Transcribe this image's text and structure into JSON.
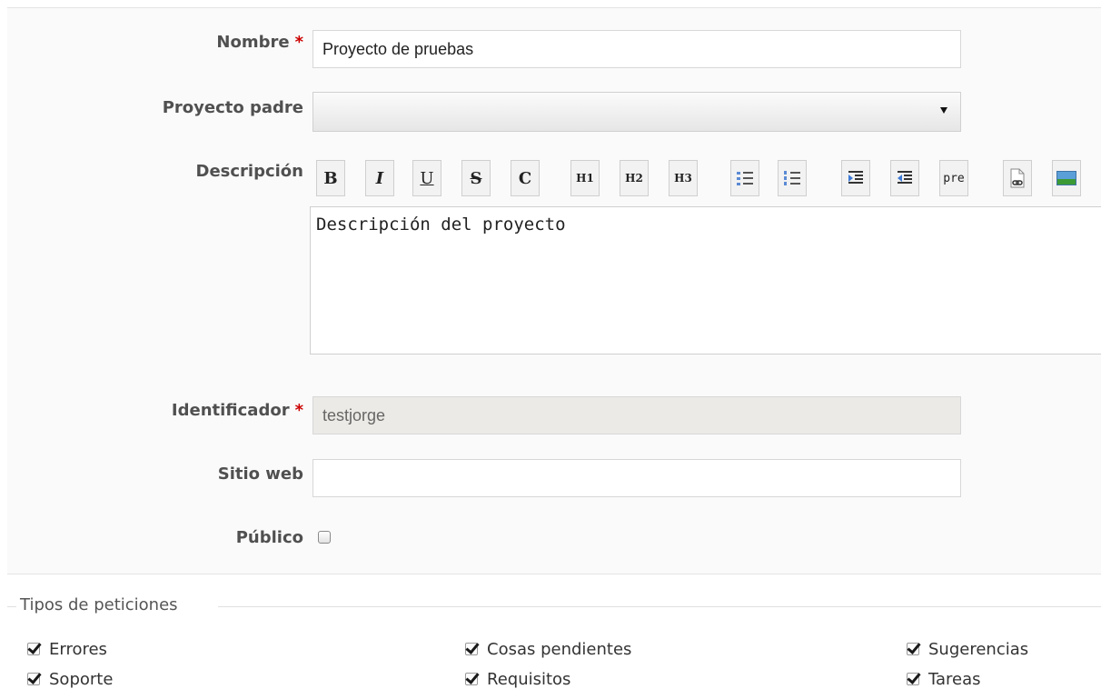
{
  "form": {
    "name": {
      "label": "Nombre",
      "required": "*",
      "value": "Proyecto de pruebas"
    },
    "parent": {
      "label": "Proyecto padre",
      "selected": ""
    },
    "description": {
      "label": "Descripción",
      "value": "Descripción del proyecto",
      "toolbar": {
        "bold": "B",
        "italic": "I",
        "underline": "U",
        "strike": "S",
        "code": "C",
        "h1": "H1",
        "h2": "H2",
        "h3": "H3",
        "pre": "pre"
      }
    },
    "identifier": {
      "label": "Identificador",
      "required": "*",
      "value": "testjorge"
    },
    "homepage": {
      "label": "Sitio web",
      "value": ""
    },
    "public": {
      "label": "Público",
      "checked": false
    }
  },
  "trackers": {
    "legend": "Tipos de peticiones",
    "items": [
      {
        "label": "Errores",
        "checked": true
      },
      {
        "label": "Cosas pendientes",
        "checked": true
      },
      {
        "label": "Sugerencias",
        "checked": true
      },
      {
        "label": "Soporte",
        "checked": true
      },
      {
        "label": "Requisitos",
        "checked": true
      },
      {
        "label": "Tareas",
        "checked": true
      }
    ]
  },
  "icons": {
    "select_arrow": "caret-down-icon",
    "ul": "unordered-list-icon",
    "ol": "ordered-list-icon",
    "indent": "indent-icon",
    "outdent": "outdent-icon",
    "link": "link-icon",
    "image": "image-icon"
  },
  "colors": {
    "required": "#cc0000",
    "panel": "#fafafa",
    "disabled_bg": "#eceae6"
  }
}
